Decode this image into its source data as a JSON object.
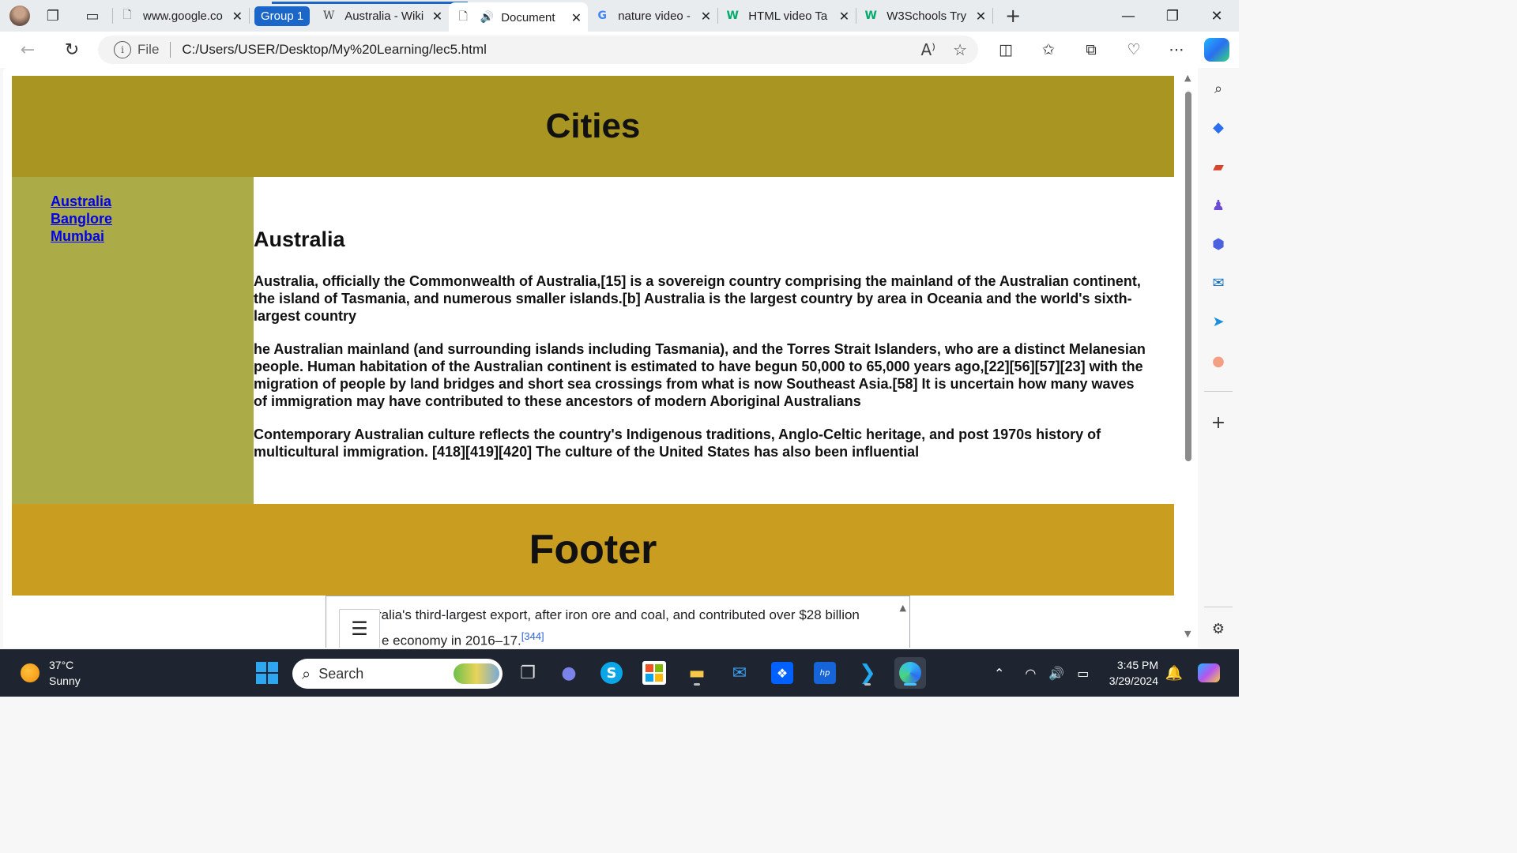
{
  "browser": {
    "tabs": [
      {
        "title": "www.google.co",
        "icon": "page-icon"
      },
      {
        "title": "Australia - Wiki",
        "icon": "wikipedia-icon"
      },
      {
        "title": "Document",
        "icon": "document-icon",
        "audio": true,
        "active": true
      },
      {
        "title": "nature video -",
        "icon": "google-icon"
      },
      {
        "title": "HTML video Ta",
        "icon": "w3schools-icon"
      },
      {
        "title": "W3Schools Try",
        "icon": "w3schools-icon"
      }
    ],
    "group_label": "Group 1",
    "address": {
      "scheme_label": "File",
      "url": "C:/Users/USER/Desktop/My%20Learning/lec5.html"
    },
    "accent": "#1a67c9"
  },
  "page": {
    "header_title": "Cities",
    "nav_links": [
      "Australia",
      "Banglore",
      "Mumbai"
    ],
    "article": {
      "heading": "Australia",
      "paragraphs": [
        "Australia, officially the Commonwealth of Australia,[15] is a sovereign country comprising the mainland of the Australian continent, the island of Tasmania, and numerous smaller islands.[b] Australia is the largest country by area in Oceania and the world's sixth-largest country",
        "he Australian mainland (and surrounding islands including Tasmania), and the Torres Strait Islanders, who are a distinct Melanesian people. Human habitation of the Australian continent is estimated to have begun 50,000 to 65,000 years ago,[22][56][57][23] with the migration of people by land bridges and short sea crossings from what is now Southeast Asia.[58] It is uncertain how many waves of immigration may have contributed to these ancestors of modern Aboriginal Australians",
        "Contemporary Australian culture reflects the country's Indigenous traditions, Anglo-Celtic heritage, and post 1970s history of multicultural immigration. [418][419][420] The culture of the United States has also been influential"
      ]
    },
    "footer_title": "Footer",
    "colors": {
      "header": "#a89522",
      "sidebar": "#abab47",
      "footer": "#c99d20"
    }
  },
  "popup": {
    "line1": "Australia's third-largest export, after iron ore and coal, and contributed over $28 billion",
    "line2": "e economy in 2016–17.",
    "ref": "[344]"
  },
  "taskbar": {
    "weather_temp": "37°C",
    "weather_desc": "Sunny",
    "search_placeholder": "Search",
    "time": "3:45 PM",
    "date": "3/29/2024"
  }
}
